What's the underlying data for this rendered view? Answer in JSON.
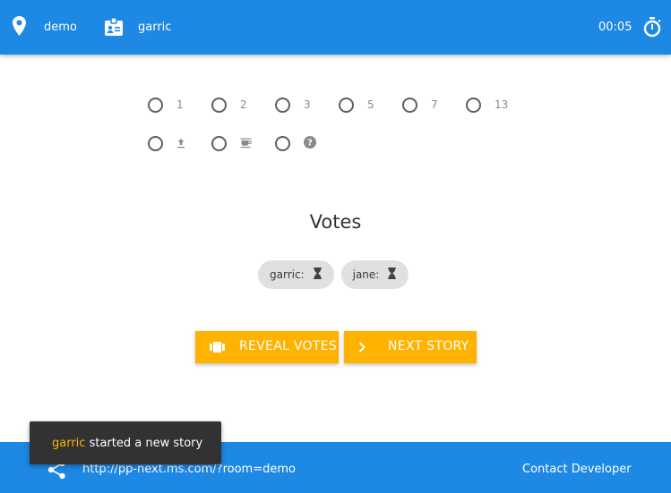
{
  "header": {
    "room_label": "demo",
    "user_label": "garric",
    "timer": "00:05",
    "icons": [
      "location-pin-icon",
      "id-badge-icon",
      "stopwatch-icon"
    ]
  },
  "cards": {
    "row1": [
      "1",
      "2",
      "3",
      "5",
      "7",
      "13"
    ],
    "row2_icons": [
      "upload-icon",
      "coffee-icon",
      "help-circle-icon"
    ]
  },
  "votes": {
    "title": "Votes",
    "participants": [
      {
        "name": "garric:",
        "status_icon": "hourglass-icon"
      },
      {
        "name": "jane:",
        "status_icon": "hourglass-icon"
      }
    ]
  },
  "actions": {
    "reveal_label": "REVEAL VOTES",
    "next_label": "NEXT STORY",
    "reveal_icon": "cards-icon",
    "next_icon": "chevron-right-icon"
  },
  "footer": {
    "url": "http://pp-next.ms.com/?room=demo",
    "contact": "Contact Developer",
    "share_icon": "share-icon"
  },
  "snackbar": {
    "user": "garric",
    "message": " started a new story"
  },
  "colors": {
    "primary": "#1e88e5",
    "accent": "#ffb300",
    "snackbar": "#323232",
    "chip": "#e0e0e0"
  }
}
